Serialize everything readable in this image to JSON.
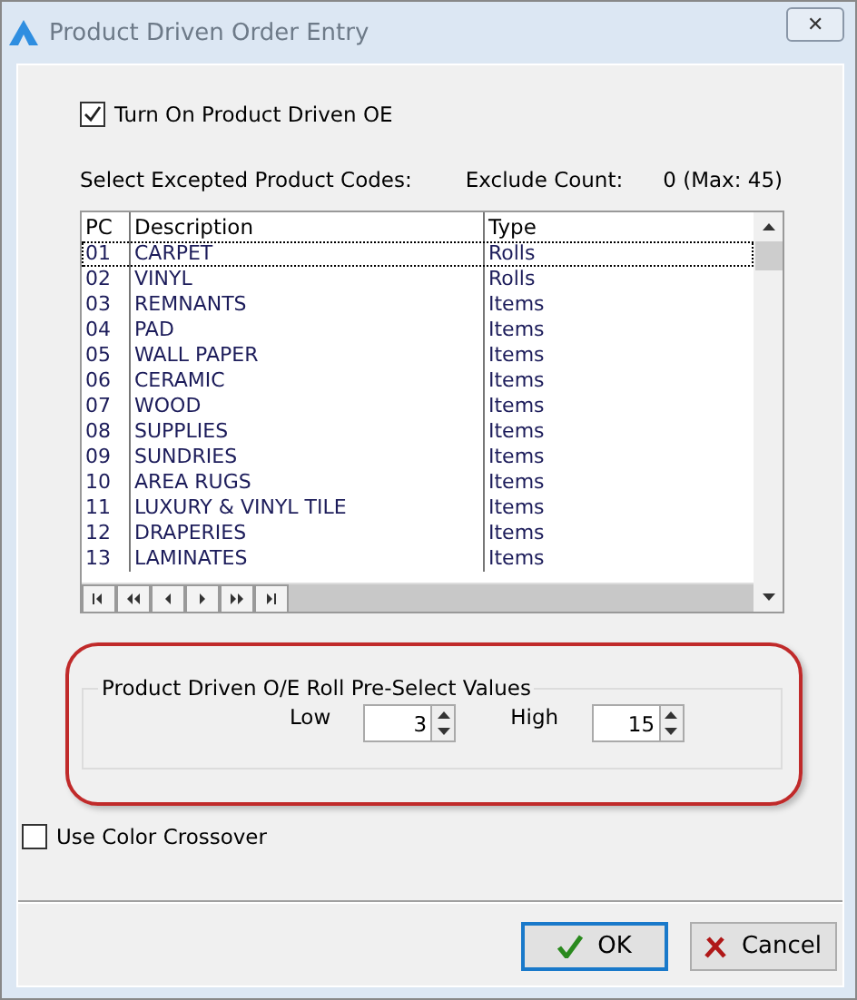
{
  "window": {
    "title": "Product Driven Order Entry",
    "close_label": "✕"
  },
  "turn_on": {
    "label": "Turn On Product Driven OE",
    "checked": true
  },
  "codes_label": "Select Excepted Product Codes:",
  "exclude_count": {
    "label": "Exclude Count:",
    "value": "0 (Max: 45)"
  },
  "table": {
    "columns": [
      "PC",
      "Description",
      "Type"
    ],
    "rows": [
      {
        "pc": "01",
        "description": "CARPET",
        "type": "Rolls",
        "selected": true
      },
      {
        "pc": "02",
        "description": "VINYL",
        "type": "Rolls",
        "selected": false
      },
      {
        "pc": "03",
        "description": "REMNANTS",
        "type": "Items",
        "selected": false
      },
      {
        "pc": "04",
        "description": "PAD",
        "type": "Items",
        "selected": false
      },
      {
        "pc": "05",
        "description": "WALL PAPER",
        "type": "Items",
        "selected": false
      },
      {
        "pc": "06",
        "description": "CERAMIC",
        "type": "Items",
        "selected": false
      },
      {
        "pc": "07",
        "description": "WOOD",
        "type": "Items",
        "selected": false
      },
      {
        "pc": "08",
        "description": "SUPPLIES",
        "type": "Items",
        "selected": false
      },
      {
        "pc": "09",
        "description": "SUNDRIES",
        "type": "Items",
        "selected": false
      },
      {
        "pc": "10",
        "description": "AREA RUGS",
        "type": "Items",
        "selected": false
      },
      {
        "pc": "11",
        "description": "LUXURY & VINYL TILE",
        "type": "Items",
        "selected": false
      },
      {
        "pc": "12",
        "description": "DRAPERIES",
        "type": "Items",
        "selected": false
      },
      {
        "pc": "13",
        "description": "LAMINATES",
        "type": "Items",
        "selected": false
      }
    ],
    "nav_buttons": [
      {
        "kind": "first"
      },
      {
        "kind": "prev-page"
      },
      {
        "kind": "prev"
      },
      {
        "kind": "next"
      },
      {
        "kind": "next-page"
      },
      {
        "kind": "last"
      }
    ]
  },
  "roll_group": {
    "title": "Product Driven O/E Roll Pre-Select Values",
    "fields": [
      {
        "label": "Low",
        "value": "3"
      },
      {
        "label": "High",
        "value": "15"
      }
    ]
  },
  "color_crossover": {
    "label": "Use Color Crossover",
    "checked": false
  },
  "buttons": [
    {
      "kind": "ok",
      "label": "OK",
      "selected": true
    },
    {
      "kind": "cancel",
      "label": "Cancel",
      "selected": false
    }
  ]
}
